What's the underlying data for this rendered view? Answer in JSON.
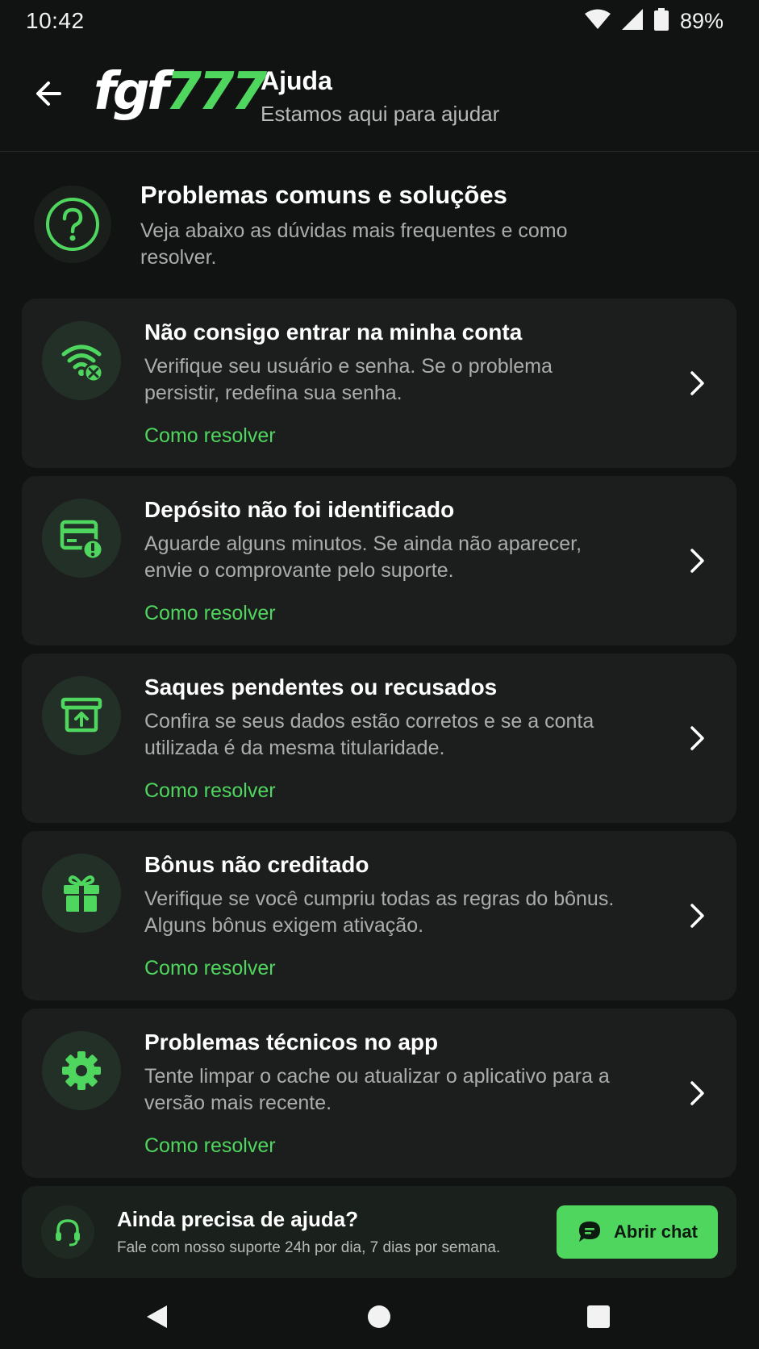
{
  "status_bar": {
    "time": "10:42",
    "battery": "89%"
  },
  "header": {
    "logo_white": "fgf",
    "logo_green": "777",
    "title": "Ajuda",
    "subtitle": "Estamos aqui para ajudar"
  },
  "intro": {
    "icon": "question-circle-icon",
    "title": "Problemas comuns e soluções",
    "description": "Veja abaixo as dúvidas mais frequentes e como resolver."
  },
  "cards": [
    {
      "icon": "wifi-off-icon",
      "title": "Não consigo entrar na minha conta",
      "description": "Verifique seu usuário e senha. Se o problema persistir, redefina sua senha.",
      "link": "Como resolver"
    },
    {
      "icon": "card-alert-icon",
      "title": "Depósito não foi identificado",
      "description": "Aguarde alguns minutos. Se ainda não aparecer, envie o comprovante pelo suporte.",
      "link": "Como resolver"
    },
    {
      "icon": "withdraw-icon",
      "title": "Saques pendentes ou recusados",
      "description": "Confira se seus dados estão corretos e se a conta utilizada é da mesma titularidade.",
      "link": "Como resolver"
    },
    {
      "icon": "gift-icon",
      "title": "Bônus não creditado",
      "description": "Verifique se você cumpriu todas as regras do bônus. Alguns bônus exigem ativação.",
      "link": "Como resolver"
    },
    {
      "icon": "gear-icon",
      "title": "Problemas técnicos no app",
      "description": "Tente limpar o cache ou atualizar o aplicativo para a versão mais recente.",
      "link": "Como resolver"
    }
  ],
  "help_banner": {
    "icon": "headset-icon",
    "title": "Ainda precisa de ajuda?",
    "description": "Fale com nosso suporte 24h por dia, 7 dias por semana.",
    "button_label": "Abrir chat"
  },
  "colors": {
    "accent": "#4fd65e",
    "background": "#111312",
    "card": "#1c1e1d"
  }
}
